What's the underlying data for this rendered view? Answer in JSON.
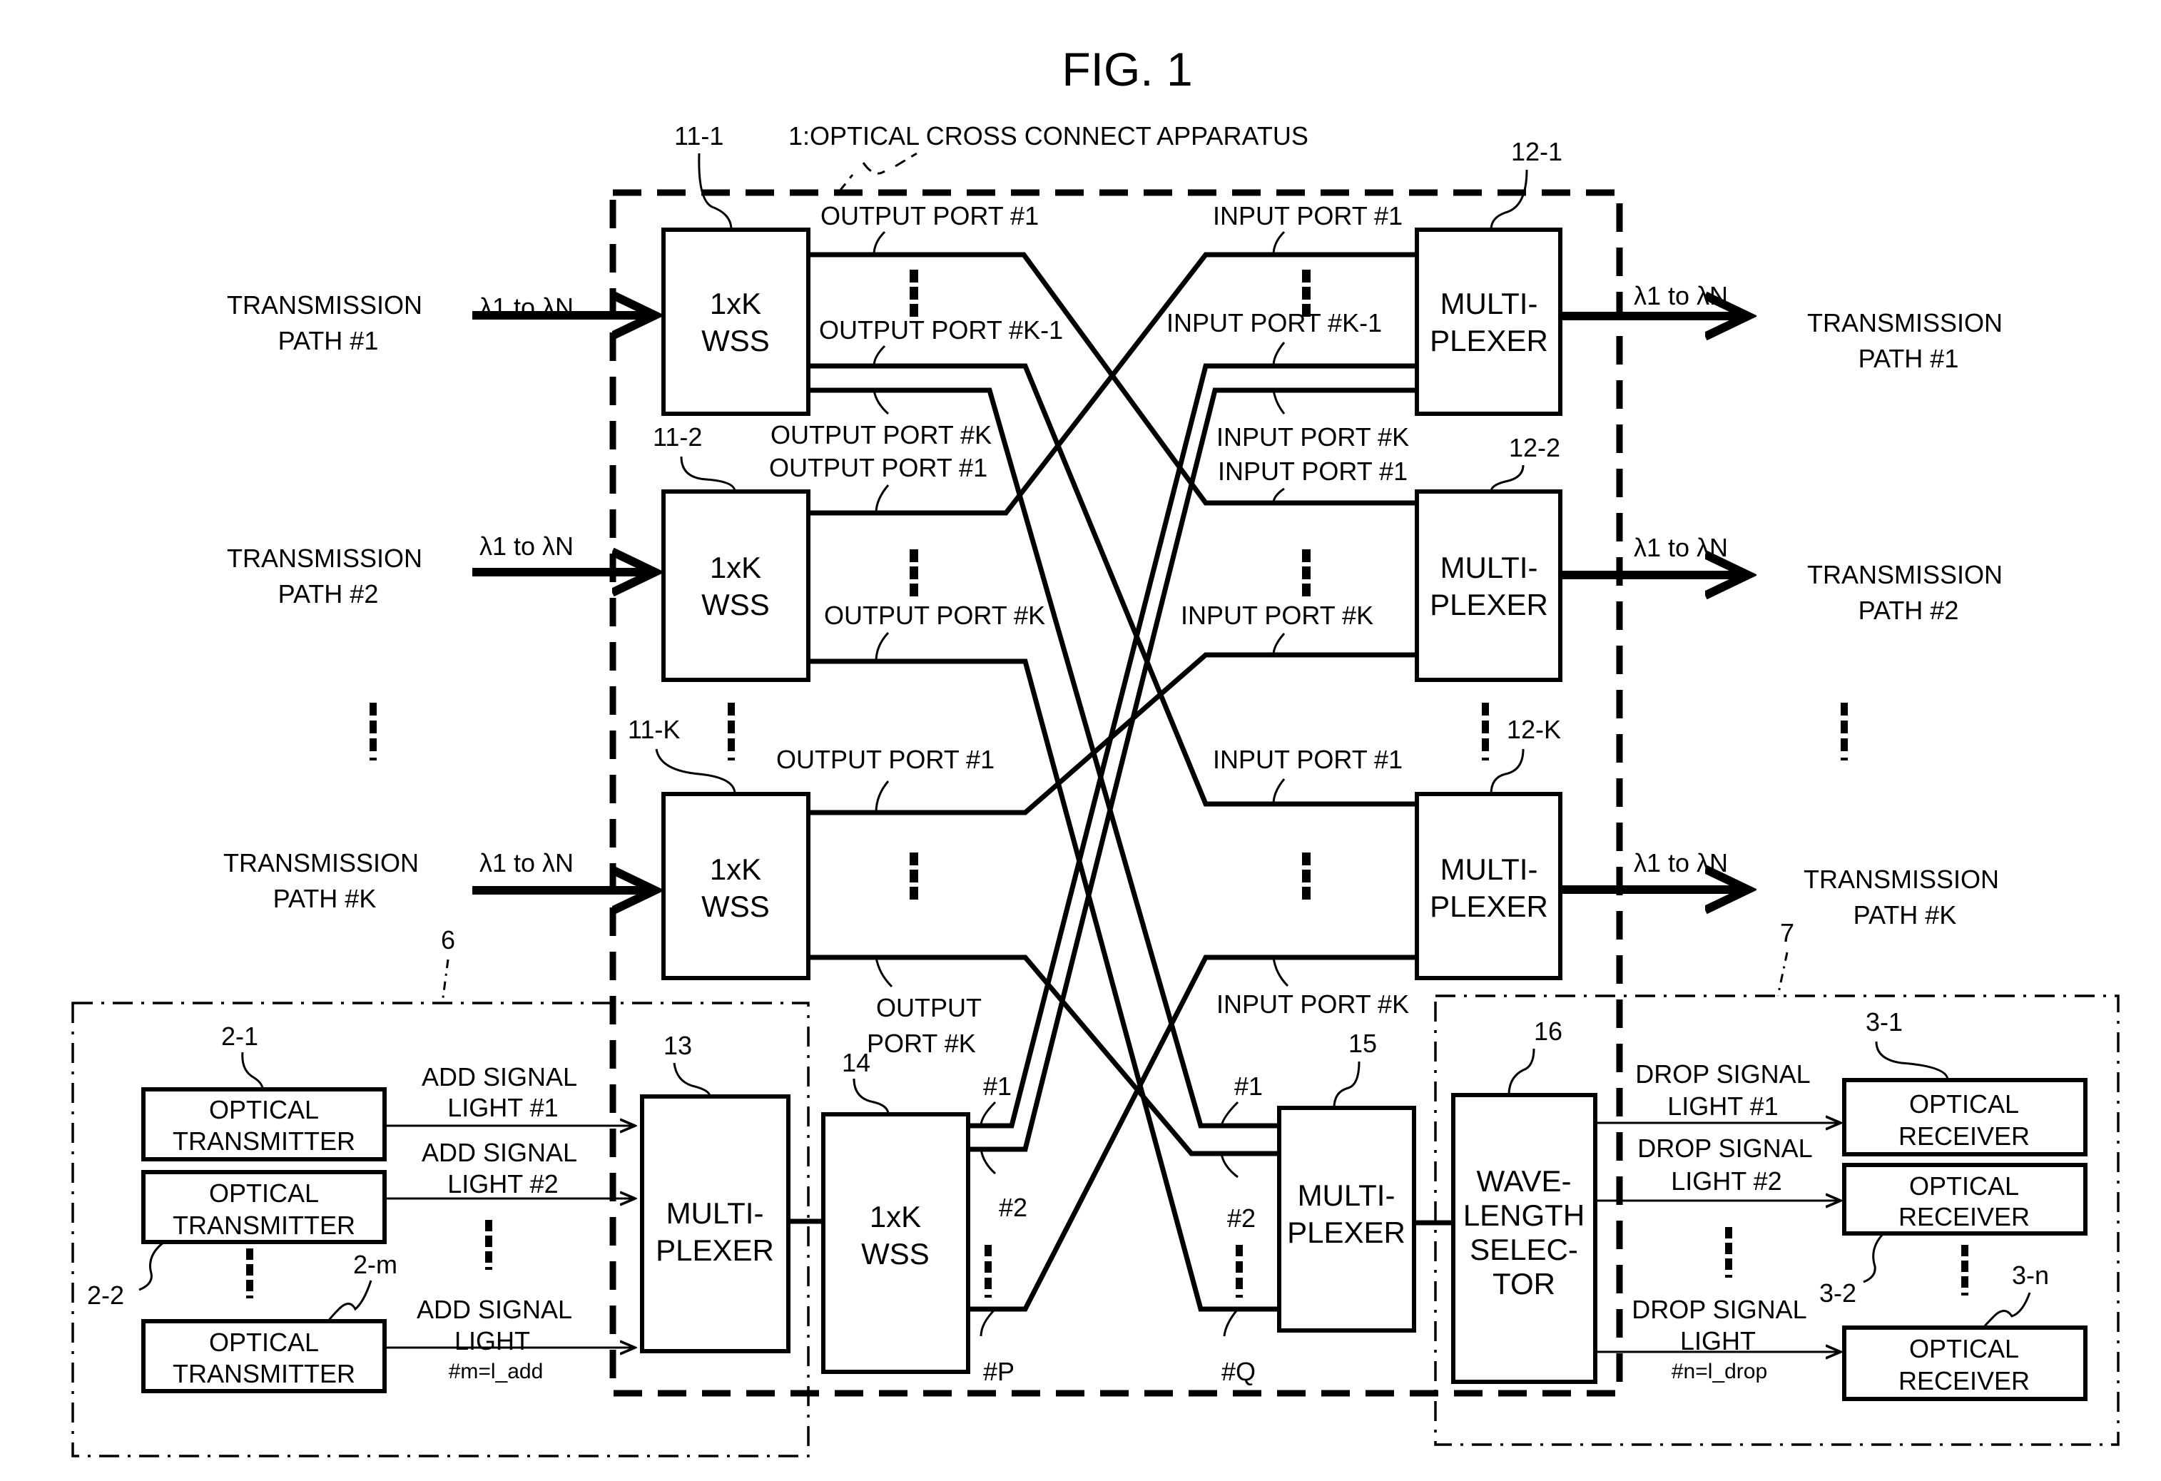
{
  "figure": {
    "title": "FIG. 1",
    "apparatus_label": "1:OPTICAL CROSS CONNECT APPARATUS"
  },
  "inputs": [
    {
      "path_label_1": "TRANSMISSION",
      "path_label_2": "PATH #1",
      "wavelength": "λ1 to λN",
      "ref": "11-1",
      "box_line1": "1xK",
      "box_line2": "WSS"
    },
    {
      "path_label_1": "TRANSMISSION",
      "path_label_2": "PATH #2",
      "wavelength": "λ1 to λN",
      "ref": "11-2",
      "box_line1": "1xK",
      "box_line2": "WSS"
    },
    {
      "path_label_1": "TRANSMISSION",
      "path_label_2": "PATH #K",
      "wavelength": "λ1 to λN",
      "ref": "11-K",
      "box_line1": "1xK",
      "box_line2": "WSS"
    }
  ],
  "outputs": [
    {
      "path_label_1": "TRANSMISSION",
      "path_label_2": "PATH #1",
      "wavelength": "λ1 to λN",
      "ref": "12-1",
      "box_line1": "MULTI-",
      "box_line2": "PLEXER"
    },
    {
      "path_label_1": "TRANSMISSION",
      "path_label_2": "PATH #2",
      "wavelength": "λ1 to λN",
      "ref": "12-2",
      "box_line1": "MULTI-",
      "box_line2": "PLEXER"
    },
    {
      "path_label_1": "TRANSMISSION",
      "path_label_2": "PATH #K",
      "wavelength": "λ1 to λN",
      "ref": "12-K",
      "box_line1": "MULTI-",
      "box_line2": "PLEXER"
    }
  ],
  "port_labels": {
    "wss1": [
      "OUTPUT PORT #1",
      "OUTPUT PORT #K-1",
      "OUTPUT PORT #K"
    ],
    "wss2": [
      "OUTPUT PORT #1",
      "OUTPUT PORT #K"
    ],
    "wssK": [
      "OUTPUT PORT #1",
      "OUTPUT",
      "PORT #K"
    ],
    "mux1": [
      "INPUT PORT #1",
      "INPUT PORT #K-1",
      "INPUT PORT #K"
    ],
    "mux2": [
      "INPUT PORT #1",
      "INPUT PORT #K"
    ],
    "muxK": [
      "INPUT PORT #1",
      "INPUT PORT #K"
    ]
  },
  "add_section": {
    "ref": "6",
    "transmitters": [
      {
        "ref": "2-1",
        "line1": "OPTICAL",
        "line2": "TRANSMITTER",
        "signal_1": "ADD SIGNAL",
        "signal_2": "LIGHT #1",
        "signal_3": ""
      },
      {
        "ref": "2-2",
        "line1": "OPTICAL",
        "line2": "TRANSMITTER",
        "signal_1": "ADD SIGNAL",
        "signal_2": "LIGHT #2",
        "signal_3": ""
      },
      {
        "ref": "2-m",
        "line1": "OPTICAL",
        "line2": "TRANSMITTER",
        "signal_1": "ADD SIGNAL",
        "signal_2": "LIGHT",
        "signal_3": "#m=l_add"
      }
    ],
    "mux": {
      "ref": "13",
      "line1": "MULTI-",
      "line2": "PLEXER"
    },
    "wss": {
      "ref": "14",
      "line1": "1xK",
      "line2": "WSS",
      "ports": [
        "#1",
        "#2",
        "#P"
      ]
    }
  },
  "drop_section": {
    "ref": "7",
    "mux": {
      "ref": "15",
      "line1": "MULTI-",
      "line2": "PLEXER",
      "ports": [
        "#1",
        "#2",
        "#Q"
      ]
    },
    "selector": {
      "ref": "16",
      "lines": [
        "WAVE-",
        "LENGTH",
        "SELEC-",
        "TOR"
      ]
    },
    "receivers": [
      {
        "ref": "3-1",
        "line1": "OPTICAL",
        "line2": "RECEIVER",
        "signal_1": "DROP SIGNAL",
        "signal_2": "LIGHT #1",
        "signal_3": ""
      },
      {
        "ref": "3-2",
        "line1": "OPTICAL",
        "line2": "RECEIVER",
        "signal_1": "DROP SIGNAL",
        "signal_2": "LIGHT #2",
        "signal_3": ""
      },
      {
        "ref": "3-n",
        "line1": "OPTICAL",
        "line2": "RECEIVER",
        "signal_1": "DROP SIGNAL",
        "signal_2": "LIGHT",
        "signal_3": "#n=l_drop"
      }
    ]
  }
}
